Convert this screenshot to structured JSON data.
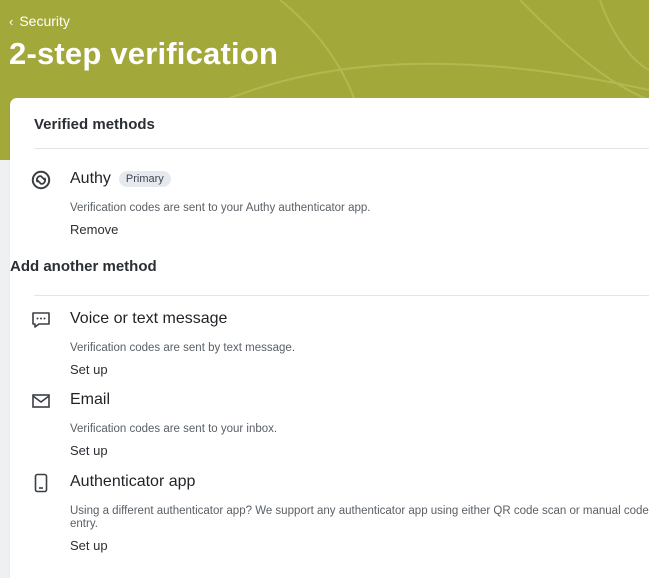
{
  "header": {
    "breadcrumb_chevron": "‹",
    "breadcrumb": "Security",
    "title": "2-step verification",
    "background_color": "#a3a83a"
  },
  "verified": {
    "heading": "Verified methods",
    "methods": [
      {
        "icon": "authy-icon",
        "name": "Authy",
        "badge": "Primary",
        "description": "Verification codes are sent to your Authy authenticator app.",
        "action": "Remove"
      }
    ]
  },
  "add": {
    "heading": "Add another method",
    "methods": [
      {
        "icon": "message-icon",
        "name": "Voice or text message",
        "description": "Verification codes are sent by text message.",
        "action": "Set up"
      },
      {
        "icon": "email-icon",
        "name": "Email",
        "description": "Verification codes are sent to your inbox.",
        "action": "Set up"
      },
      {
        "icon": "phone-icon",
        "name": "Authenticator app",
        "description": "Using a different authenticator app? We support any authenticator app using either QR code scan or manual code entry.",
        "action": "Set up"
      }
    ]
  }
}
